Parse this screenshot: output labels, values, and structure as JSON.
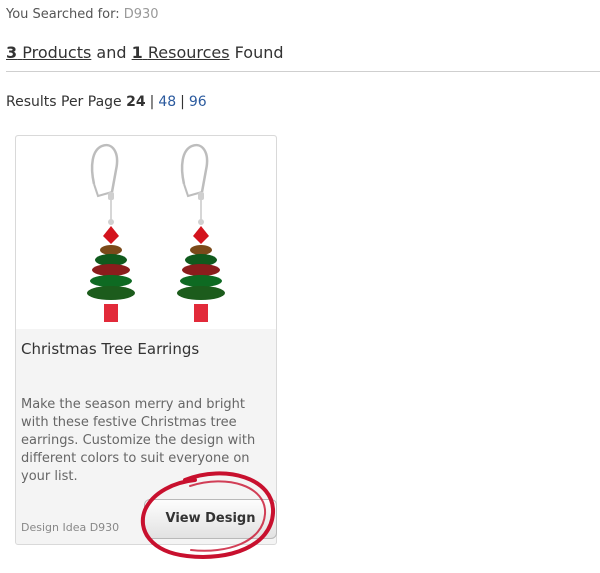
{
  "search": {
    "prefix": "You Searched for: ",
    "term": "D930"
  },
  "results": {
    "products_count": "3",
    "products_label": "Products",
    "and": "and",
    "resources_count": "1",
    "resources_label": "Resources",
    "found": "Found"
  },
  "per_page": {
    "label": "Results Per Page",
    "current": "24",
    "options": [
      "48",
      "96"
    ],
    "separator": "|"
  },
  "card": {
    "title": "Christmas Tree Earrings",
    "description": "Make the season merry and bright with these festive Christmas tree earrings. Customize the design with different colors to suit everyone on your list.",
    "idea_label": "Design Idea D930",
    "button_label": "View Design"
  },
  "colors": {
    "link": "#2b5a9e",
    "annotation": "#c8102e"
  }
}
